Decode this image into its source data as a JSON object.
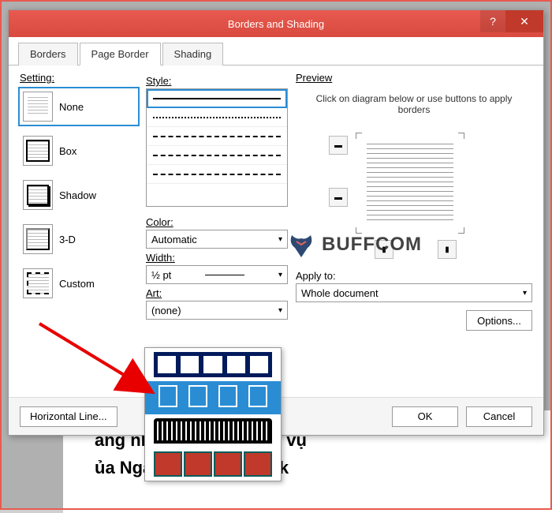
{
  "titlebar": {
    "title": "Borders and Shading"
  },
  "tabs": {
    "borders": "Borders",
    "page_border": "Page Border",
    "shading": "Shading"
  },
  "settings": {
    "label": "Setting:",
    "none": "None",
    "box": "Box",
    "shadow": "Shadow",
    "three_d": "3-D",
    "custom": "Custom"
  },
  "style": {
    "label": "Style:"
  },
  "color": {
    "label": "Color:",
    "value": "Automatic"
  },
  "width": {
    "label": "Width:",
    "value": "½ pt"
  },
  "art": {
    "label": "Art:",
    "value": "(none)"
  },
  "preview": {
    "label": "Preview",
    "hint": "Click on diagram below or use buttons to apply borders"
  },
  "apply": {
    "label": "Apply to:",
    "value": "Whole document"
  },
  "buttons": {
    "options": "Options...",
    "horizontal_line": "Horizontal Line...",
    "ok": "OK",
    "cancel": "Cancel"
  },
  "bg_document": {
    "line1": "ăng nhận thức về Dịch vụ",
    "line2": "ủa Ngân hàng Agribank"
  },
  "watermark": {
    "text": "BUFFCOM"
  }
}
